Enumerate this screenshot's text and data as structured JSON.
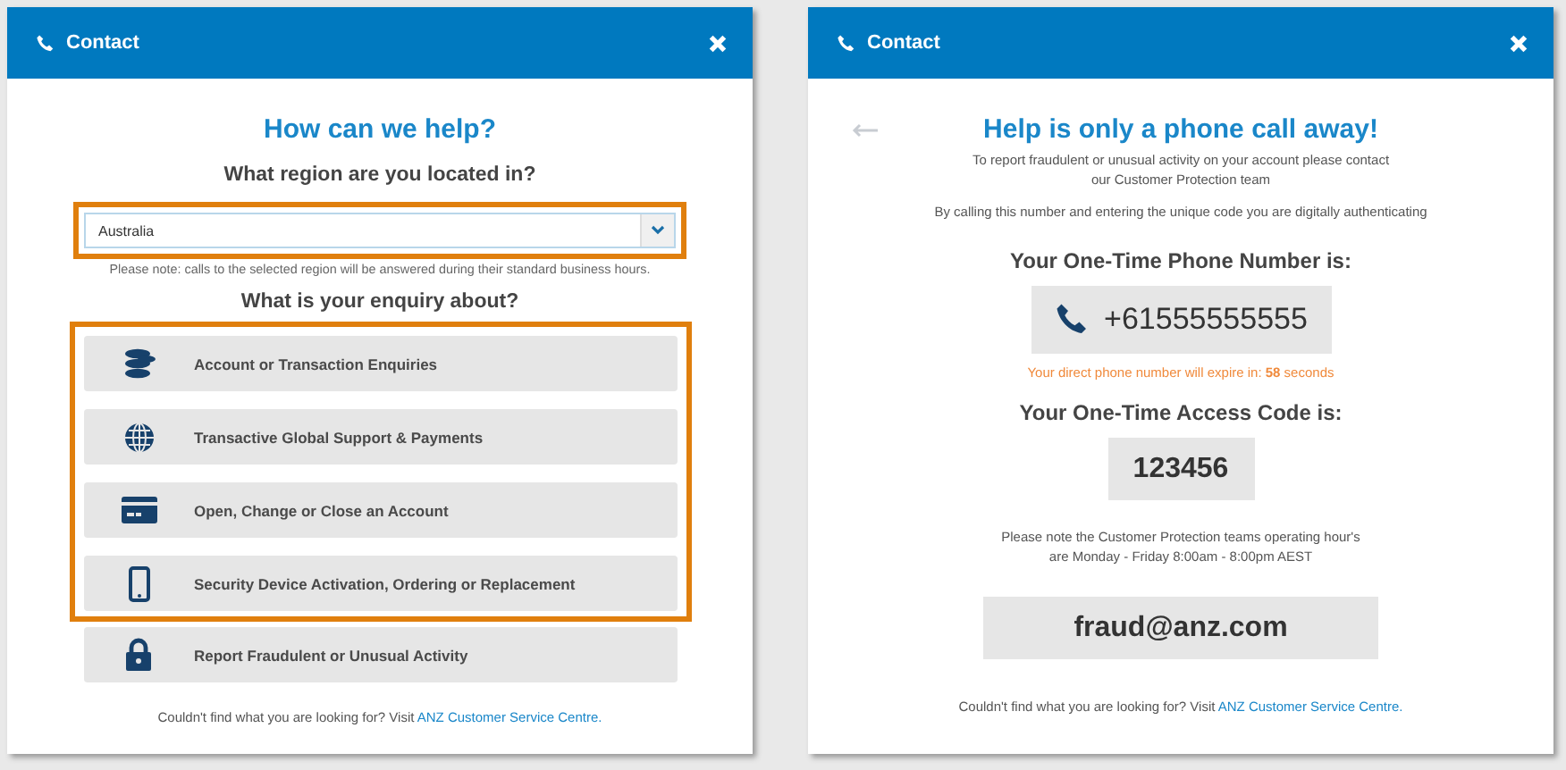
{
  "left_panel": {
    "title": "Contact",
    "heading": "How can we help?",
    "region_question": "What region are you located in?",
    "region": {
      "value": "Australia",
      "highlighted": true
    },
    "region_note": "Please note: calls to the selected region will be answered during their standard business hours.",
    "enquiry_question": "What is your enquiry about?",
    "options": [
      {
        "label": "Account or Transaction Enquiries",
        "kind": "coins",
        "highlighted": true
      },
      {
        "label": "Transactive Global Support & Payments",
        "kind": "globe",
        "highlighted": true
      },
      {
        "label": "Open, Change or Close an Account",
        "kind": "card",
        "highlighted": true
      },
      {
        "label": "Security Device Activation, Ordering or Replacement",
        "kind": "mobile",
        "highlighted": true
      },
      {
        "label": "Report Fraudulent or Unusual Activity",
        "kind": "lock",
        "highlighted": false
      }
    ],
    "footer": {
      "text": "Couldn't find what you are looking for? Visit",
      "link": "ANZ Customer Service Centre."
    }
  },
  "right_panel": {
    "title": "Contact",
    "heading": "Help is only a phone call away!",
    "intro": [
      "To report fraudulent or unusual activity on your account please contact",
      "our Customer Protection team"
    ],
    "auth_note": "By calling this number and entering the unique code you are digitally authenticating",
    "phone_label": "Your One-Time Phone Number is:",
    "phone": "+61555555555",
    "expiry": "Your direct phone number will expire in: **58** seconds",
    "code_label": "Your One-Time Access Code is:",
    "code": "123456",
    "hours": [
      "Please note the Customer Protection teams operating hour's",
      "are Monday - Friday 8:00am - 8:00pm AEST"
    ],
    "email": "fraud@anz.com",
    "footer": {
      "text": "Couldn't find what you are looking for? Visit",
      "link": "ANZ Customer Service Centre."
    }
  }
}
